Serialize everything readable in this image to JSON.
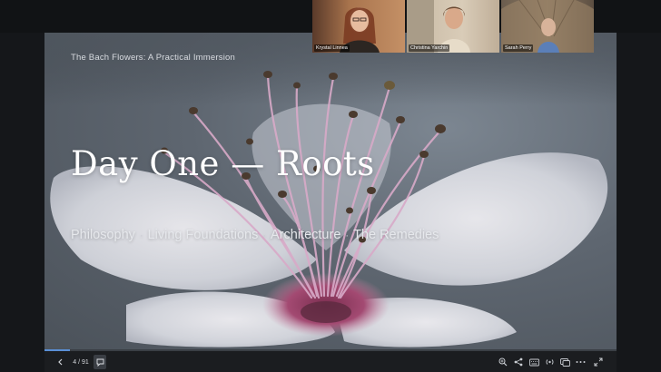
{
  "slide": {
    "header": "The Bach Flowers: A Practical Immersion",
    "title": "Day One — Roots",
    "topics": [
      "Philosophy",
      "Living Foundations",
      "Architecture",
      "The Remedies"
    ],
    "separator": "·"
  },
  "participants": [
    {
      "name": "Krystal Linnea"
    },
    {
      "name": "Christina Yarchin"
    },
    {
      "name": "Sarah Perry"
    }
  ],
  "toolbar": {
    "page_counter": "4 / 91",
    "progress": 0.044,
    "icons": [
      "prev-icon",
      "chat-icon",
      "zoom-icon",
      "share-icon",
      "keyboard-icon",
      "broadcast-icon",
      "fullscreen-window-icon",
      "more-icon",
      "expand-icon"
    ]
  },
  "colors": {
    "slide_background": "#5e6670",
    "petal": "#dcdfe6",
    "stamen_pink": "#d9a9c9",
    "anther": "#4a3a2e",
    "accent": "#5a8fd6"
  }
}
